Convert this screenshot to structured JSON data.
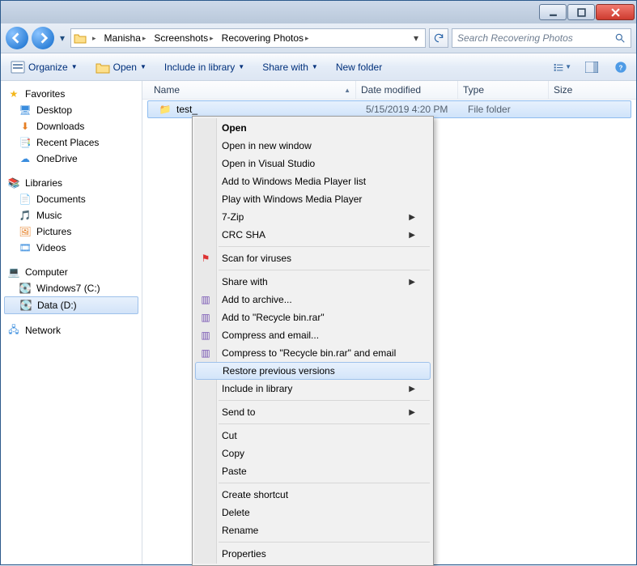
{
  "breadcrumb": [
    "Manisha",
    "Screenshots",
    "Recovering Photos"
  ],
  "search": {
    "placeholder": "Search Recovering Photos"
  },
  "toolbar": {
    "organize": "Organize",
    "open": "Open",
    "include": "Include in library",
    "share": "Share with",
    "newfolder": "New folder"
  },
  "columns": {
    "name": "Name",
    "date": "Date modified",
    "type": "Type",
    "size": "Size"
  },
  "row": {
    "name": "test_",
    "date": "5/15/2019 4:20 PM",
    "type": "File folder"
  },
  "sidebar": {
    "favorites": {
      "head": "Favorites",
      "items": [
        "Desktop",
        "Downloads",
        "Recent Places",
        "OneDrive"
      ]
    },
    "libraries": {
      "head": "Libraries",
      "items": [
        "Documents",
        "Music",
        "Pictures",
        "Videos"
      ]
    },
    "computer": {
      "head": "Computer",
      "items": [
        "Windows7 (C:)",
        "Data (D:)"
      ]
    },
    "network": {
      "head": "Network"
    }
  },
  "context": {
    "open": "Open",
    "open_new": "Open in new window",
    "open_vs": "Open in Visual Studio",
    "wmp_add": "Add to Windows Media Player list",
    "wmp_play": "Play with Windows Media Player",
    "sevenzip": "7-Zip",
    "crcsha": "CRC SHA",
    "scan": "Scan for viruses",
    "sharewith": "Share with",
    "addarch": "Add to archive...",
    "addrar": "Add to \"Recycle bin.rar\"",
    "compemail": "Compress and email...",
    "compraremail": "Compress to \"Recycle bin.rar\" and email",
    "restore": "Restore previous versions",
    "include": "Include in library",
    "sendto": "Send to",
    "cut": "Cut",
    "copy": "Copy",
    "paste": "Paste",
    "shortcut": "Create shortcut",
    "delete": "Delete",
    "rename": "Rename",
    "properties": "Properties"
  }
}
